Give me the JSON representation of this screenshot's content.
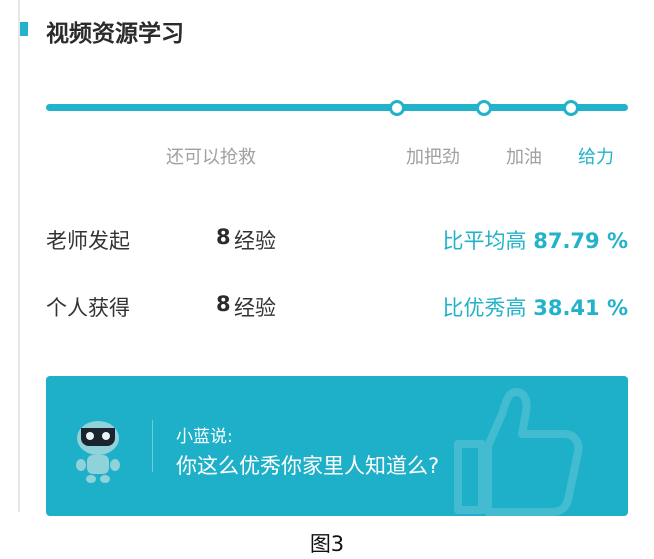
{
  "header": {
    "title": "视频资源学习"
  },
  "progress": {
    "levels": [
      {
        "label": "还可以抢救",
        "active": false
      },
      {
        "label": "加把劲",
        "active": false
      },
      {
        "label": "加油",
        "active": false
      },
      {
        "label": "给力",
        "active": true
      }
    ],
    "accent": "#22b2ca"
  },
  "stats": [
    {
      "label": "老师发起",
      "value": "8",
      "unit": "经验",
      "compare_text": "比平均高",
      "percent": "87.79 %"
    },
    {
      "label": "个人获得",
      "value": "8",
      "unit": "经验",
      "compare_text": "比优秀高",
      "percent": "38.41 %"
    }
  ],
  "banner": {
    "speaker": "小蓝说:",
    "message": "你这么优秀你家里人知道么?",
    "background": "#1fb0c9",
    "icons": [
      "robot-mascot",
      "thumbs-up"
    ]
  },
  "figure_caption": "图3"
}
